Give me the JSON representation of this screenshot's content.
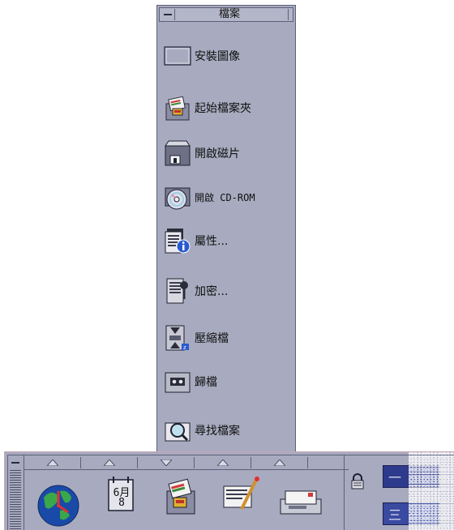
{
  "subpanel": {
    "title": "檔案",
    "items": [
      {
        "label": "安裝圖像",
        "icon": "install-icon-empty"
      },
      {
        "label": "起始檔案夾",
        "icon": "home-folder-icon"
      },
      {
        "label": "開啟磁片",
        "icon": "floppy-drive-icon"
      },
      {
        "label": "開啟 CD-ROM",
        "icon": "cdrom-icon"
      },
      {
        "label": "屬性...",
        "icon": "properties-icon"
      },
      {
        "label": "加密...",
        "icon": "encrypt-icon"
      },
      {
        "label": "壓縮檔",
        "icon": "compress-icon"
      },
      {
        "label": "歸檔",
        "icon": "archive-icon"
      },
      {
        "label": "尋找檔案",
        "icon": "find-file-icon"
      }
    ]
  },
  "frontpanel": {
    "calendar": {
      "month": "6月",
      "day": "8"
    },
    "controls": [
      "world-clock-icon",
      "calendar-icon",
      "file-manager-icon",
      "text-editor-icon",
      "mailer-icon"
    ],
    "arrows": [
      "up",
      "up",
      "down",
      "up",
      "up"
    ],
    "workspaces": [
      "一",
      "三"
    ]
  },
  "colors": {
    "panel": "#a8abbf",
    "panel_dark": "#5c5f78",
    "workspace_active": "#2e3a8c"
  }
}
